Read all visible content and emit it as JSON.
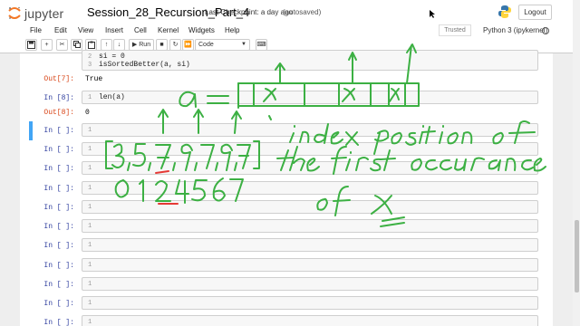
{
  "header": {
    "logo_text": "jupyter",
    "notebook_name": "Session_28_Recursion_Part_4",
    "checkpoint": "Last Checkpoint: a day ago",
    "autosave": "(autosaved)",
    "logout_label": "Logout"
  },
  "menubar": {
    "items": [
      "File",
      "Edit",
      "View",
      "Insert",
      "Cell",
      "Kernel",
      "Widgets",
      "Help"
    ],
    "trusted_label": "Trusted",
    "kernel_label": "Python 3 (ipykernel)"
  },
  "toolbar": {
    "run_label": "Run",
    "cell_type": "Code"
  },
  "cells": {
    "prev": {
      "lines": [
        {
          "num": "2",
          "code": "si = 0"
        },
        {
          "num": "3",
          "code": "isSortedBetter(a, si)"
        }
      ]
    },
    "out7": {
      "prompt": "Out[7]:",
      "value": "True"
    },
    "in8": {
      "prompt": "In [8]:",
      "num": "1",
      "code": "len(a)"
    },
    "out8": {
      "prompt": "Out[8]:",
      "value": "0"
    },
    "empty_prompt": "In [ ]:",
    "empty_num": "1"
  },
  "annotation": {
    "color": "#3cb043",
    "lines": [
      "index position of",
      "the first occurance",
      "of x"
    ]
  }
}
